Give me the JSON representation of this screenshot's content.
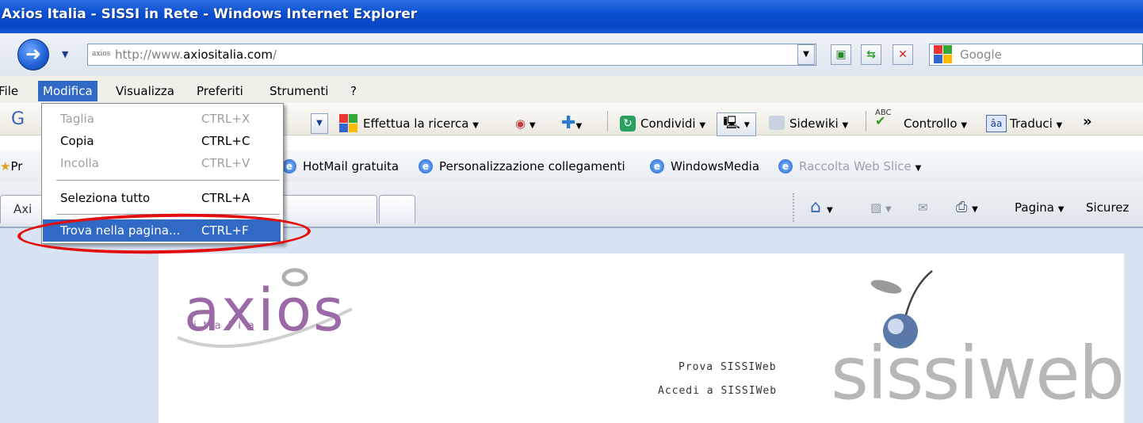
{
  "window": {
    "title": "Axios Italia - SISSI in Rete - Windows Internet Explorer"
  },
  "address_bar": {
    "url_prefix": "http://www.",
    "url_domain": "axiositalia.com",
    "url_suffix": "/",
    "favicon_text": "axios",
    "search_placeholder": "Google"
  },
  "menu_bar": [
    "File",
    "Modifica",
    "Visualizza",
    "Preferiti",
    "Strumenti",
    "?"
  ],
  "google_toolbar": {
    "search_label": "Effettua la ricerca",
    "share_label": "Condividi",
    "sidewiki_label": "Sidewiki",
    "check_label": "Controllo",
    "translate_label": "Traduci",
    "more": "»"
  },
  "links_bar": {
    "items": [
      "HotMail gratuita",
      "Personalizzazione collegamenti",
      "WindowsMedia",
      "Raccolta Web Slice"
    ],
    "left_fragment": "Pr"
  },
  "tabs": {
    "active_fragment": "Axi"
  },
  "command_bar": {
    "page_label": "Pagina",
    "security_label": "Sicurez"
  },
  "edit_menu": {
    "items": [
      {
        "label": "Taglia",
        "shortcut": "CTRL+X",
        "enabled": false
      },
      {
        "label": "Copia",
        "shortcut": "CTRL+C",
        "enabled": true
      },
      {
        "label": "Incolla",
        "shortcut": "CTRL+V",
        "enabled": false
      },
      {
        "label": "Seleziona tutto",
        "shortcut": "CTRL+A",
        "enabled": true
      },
      {
        "label": "Trova nella pagina...",
        "shortcut": "CTRL+F",
        "enabled": true,
        "highlighted": true
      }
    ]
  },
  "page": {
    "logo_axios": "axios",
    "logo_axios_sub": "italia",
    "link_try": "Prova SISSIWeb",
    "link_access": "Accedi a SISSIWeb",
    "logo_sissiweb": "sissiweb"
  },
  "colors": {
    "highlight": "#316ac5",
    "annotation": "#e30d0d",
    "axios_purple": "#9b6aa6"
  }
}
